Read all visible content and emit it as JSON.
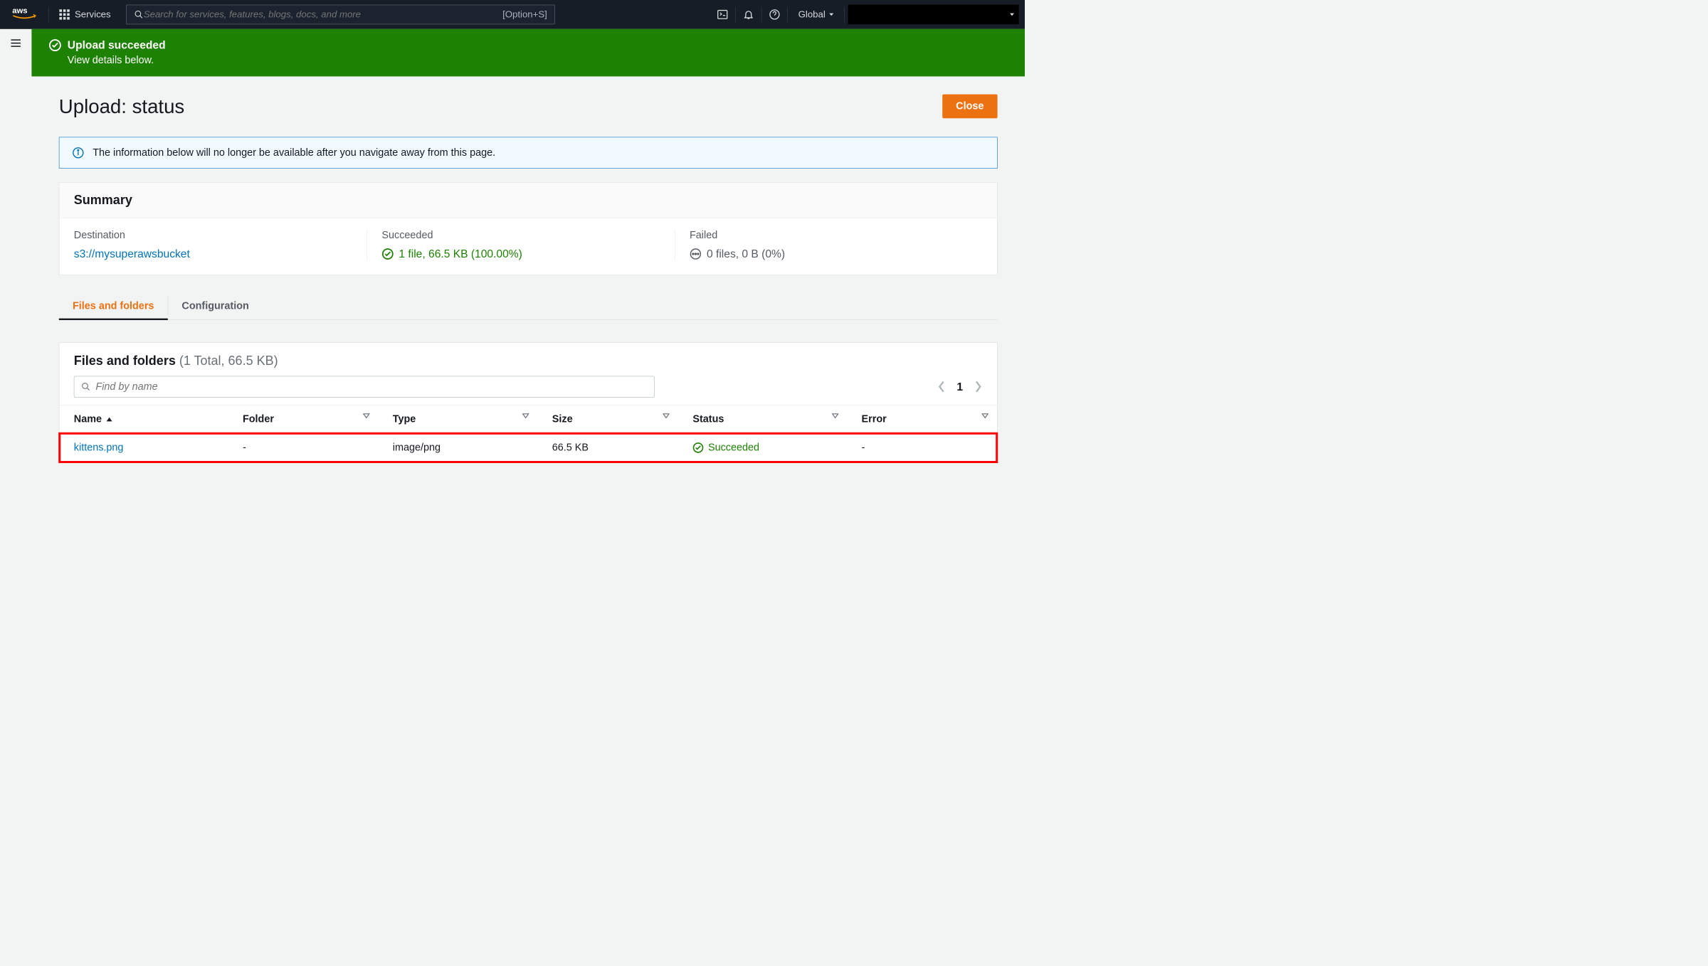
{
  "nav": {
    "services_label": "Services",
    "search_placeholder": "Search for services, features, blogs, docs, and more",
    "search_shortcut": "[Option+S]",
    "region": "Global"
  },
  "banner": {
    "title": "Upload succeeded",
    "subtitle": "View details below."
  },
  "page": {
    "title": "Upload: status",
    "close_label": "Close",
    "info_text": "The information below will no longer be available after you navigate away from this page."
  },
  "summary": {
    "heading": "Summary",
    "destination_label": "Destination",
    "destination_value": "s3://mysuperawsbucket",
    "succeeded_label": "Succeeded",
    "succeeded_value": "1 file, 66.5 KB (100.00%)",
    "failed_label": "Failed",
    "failed_value": "0 files, 0 B (0%)"
  },
  "tabs": {
    "files": "Files and folders",
    "config": "Configuration"
  },
  "table": {
    "title": "Files and folders",
    "subtitle": "(1 Total, 66.5 KB)",
    "find_placeholder": "Find by name",
    "page_number": "1",
    "columns": {
      "name": "Name",
      "folder": "Folder",
      "type": "Type",
      "size": "Size",
      "status": "Status",
      "error": "Error"
    },
    "rows": [
      {
        "name": "kittens.png",
        "folder": "-",
        "type": "image/png",
        "size": "66.5 KB",
        "status": "Succeeded",
        "error": "-"
      }
    ]
  }
}
